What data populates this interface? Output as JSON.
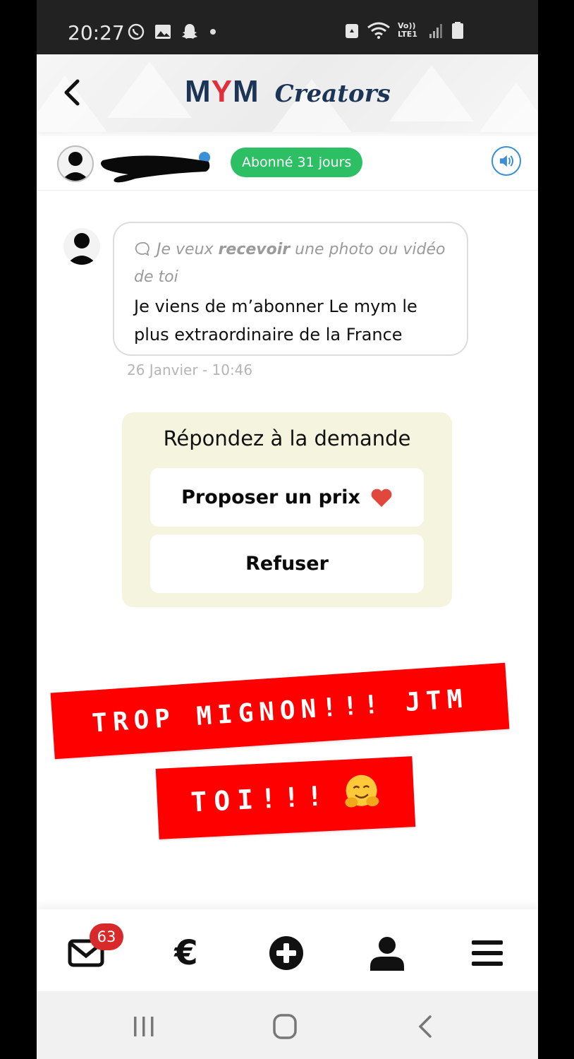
{
  "status_bar": {
    "time": "20:27",
    "network": "Vo)) LTE1"
  },
  "header": {
    "brand_primary": "MYM",
    "brand_secondary": "Creators",
    "colors": {
      "navy": "#1c3557",
      "red": "#e42d3a"
    }
  },
  "user_bar": {
    "subscription_badge": "Abonné 31 jours",
    "badge_color": "#2dbf64"
  },
  "message": {
    "request_prefix": "Je veux",
    "request_bold": "recevoir",
    "request_suffix": "une photo ou vidéo de toi",
    "text": "Je viens de m’abonner Le mym le plus extraordinaire de la France",
    "timestamp": "26 Janvier - 10:46"
  },
  "response": {
    "title": "Répondez à la demande",
    "propose_label": "Proposer un prix",
    "refuse_label": "Refuser"
  },
  "stickers": {
    "line1": "TROP MIGNON!!! JTM",
    "line2": "TOI!!!",
    "emoji": "🤗"
  },
  "bottom_nav": {
    "messages_badge": "63",
    "items": [
      "mail-icon",
      "euro-icon",
      "plus-circle-icon",
      "user-icon",
      "menu-icon"
    ],
    "euro_symbol": "€"
  }
}
